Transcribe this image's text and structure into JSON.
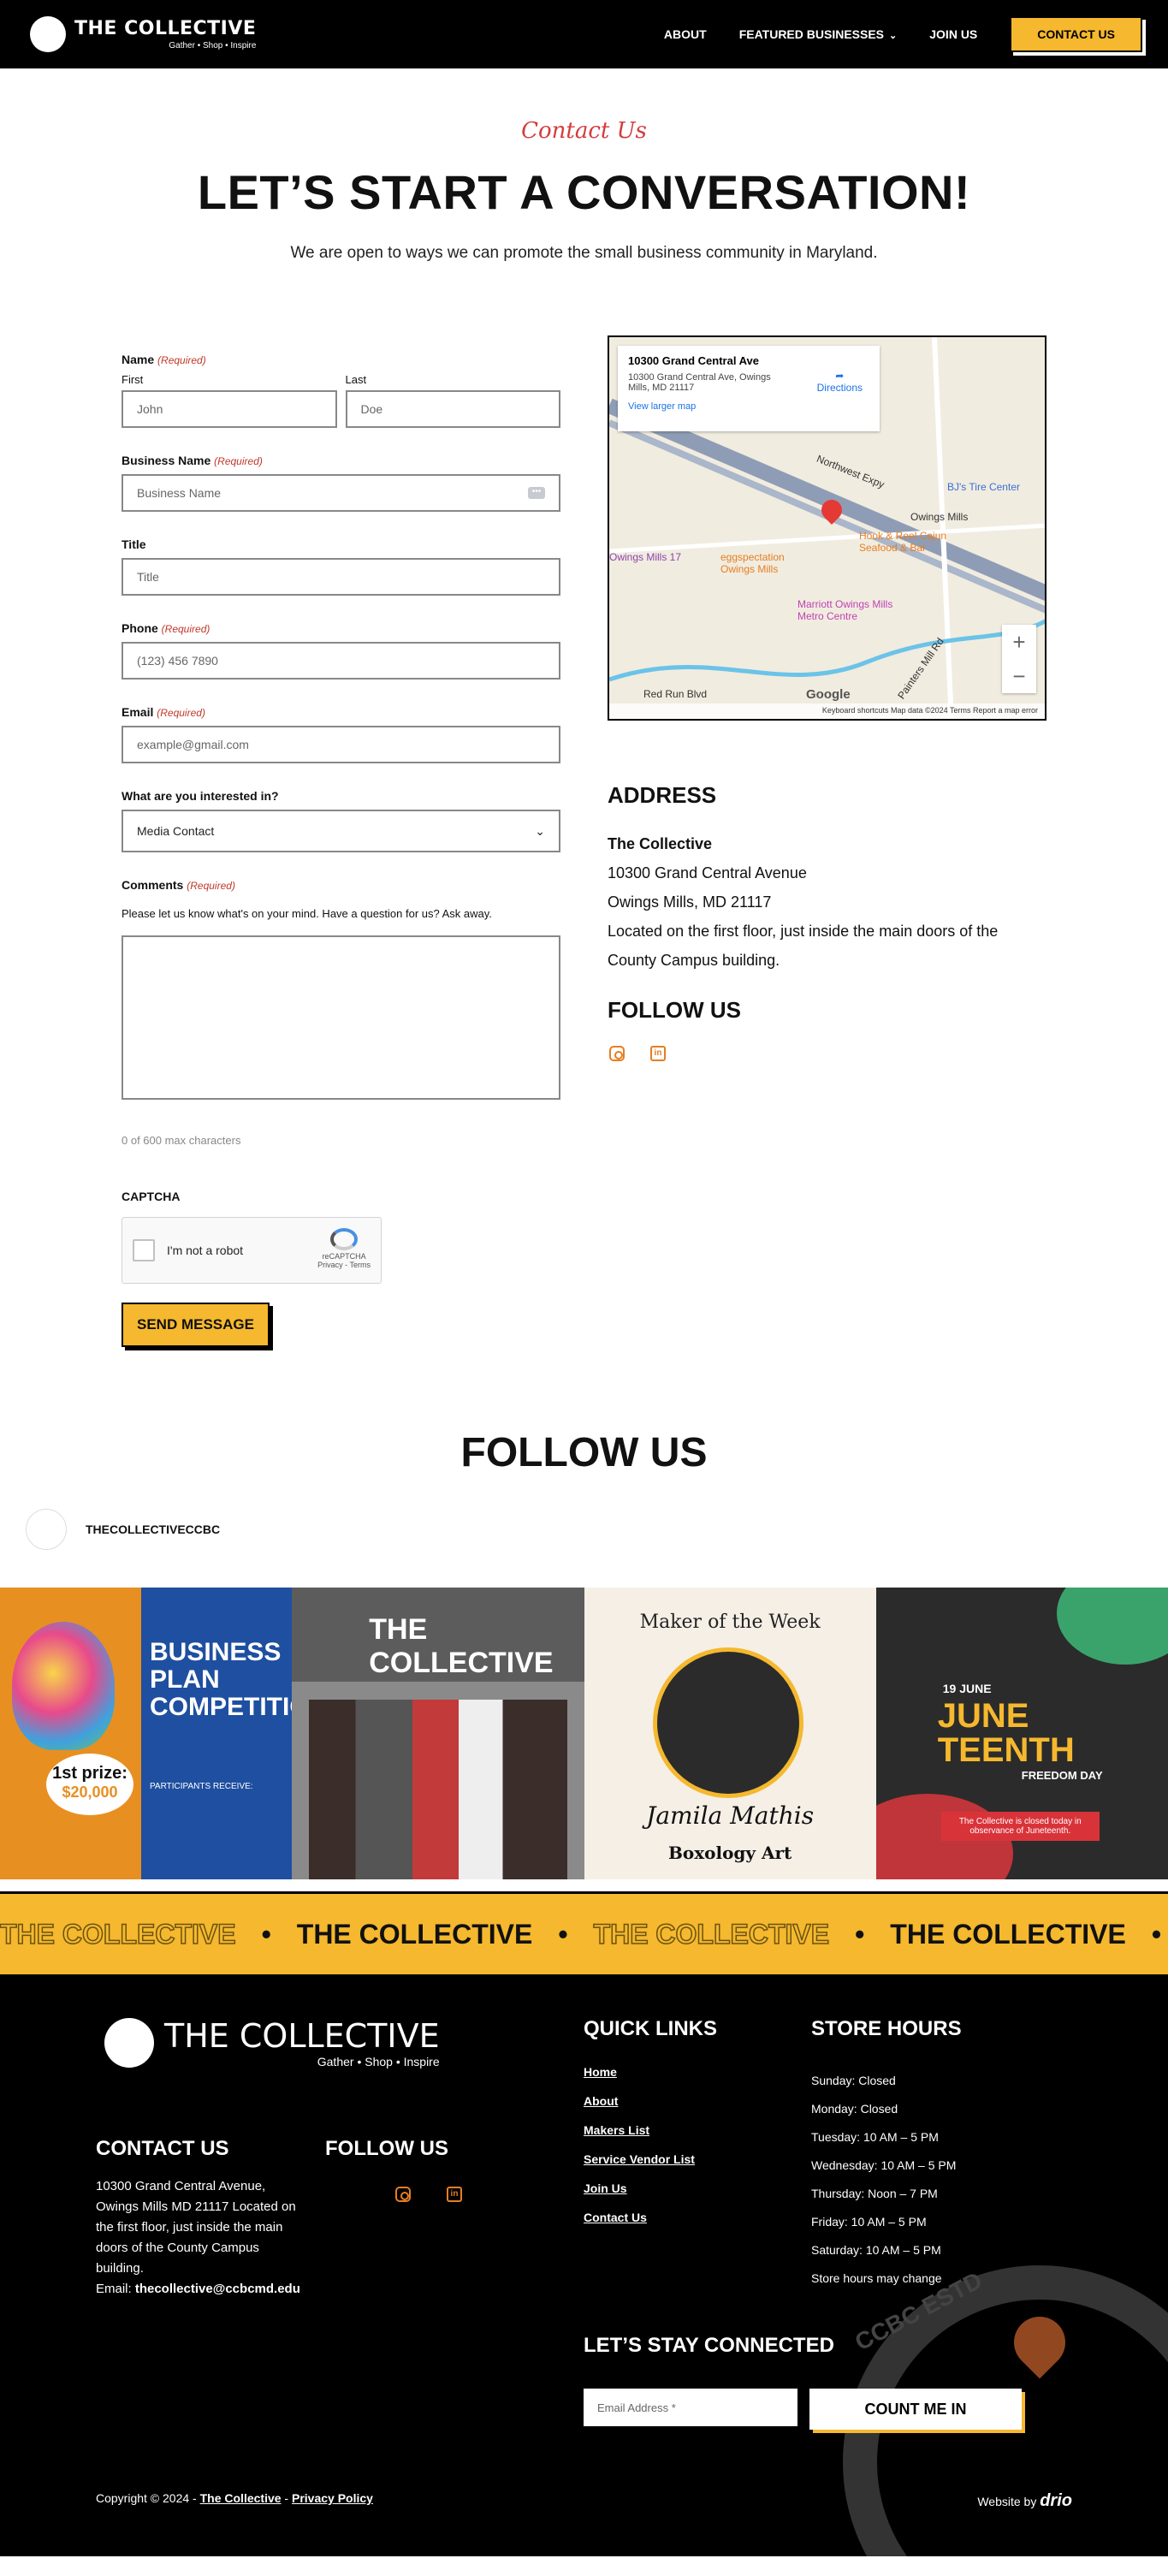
{
  "header": {
    "logo_title": "THE COLLECTIVE",
    "logo_sub": "Gather • Shop • Inspire",
    "nav": {
      "about": "ABOUT",
      "featured": "FEATURED BUSINESSES",
      "join": "JOIN US",
      "contact": "CONTACT US"
    }
  },
  "hero": {
    "eyebrow": "Contact Us",
    "title": "LET’S START A CONVERSATION!",
    "subtitle": "We are open to ways we can promote the small business community in Maryland."
  },
  "form": {
    "required": "(Required)",
    "name_label": "Name",
    "first_label": "First",
    "last_label": "Last",
    "first_placeholder": "John",
    "last_placeholder": "Doe",
    "business_label": "Business Name",
    "business_placeholder": "Business Name",
    "title_label": "Title",
    "title_placeholder": "Title",
    "phone_label": "Phone",
    "phone_placeholder": "(123) 456 7890",
    "email_label": "Email",
    "email_placeholder": "example@gmail.com",
    "interest_label": "What are you interested in?",
    "interest_value": "Media Contact",
    "comments_label": "Comments",
    "comments_hint": "Please let us know what's on your mind. Have a question for us? Ask away.",
    "counter": "0 of 600 max characters",
    "captcha_label": "CAPTCHA",
    "captcha_text": "I'm not a robot",
    "captcha_brand": "reCAPTCHA",
    "captcha_links": "Privacy - Terms",
    "submit": "SEND MESSAGE"
  },
  "map": {
    "place": "10300 Grand Central Ave",
    "address": "10300 Grand Central Ave, Owings Mills, MD 21117",
    "directions": "Directions",
    "view_larger": "View larger map",
    "labels": {
      "a": "Northwest Expy",
      "b": "Hook & Reel Cajun Seafood & Bar",
      "c": "Owings Mills",
      "d": "Marriott Owings Mills Metro Centre",
      "e": "BJ's Tire Center",
      "f": "eggspectation Owings Mills",
      "g": "Owings Mills 17",
      "h": "Painters Mill Rd",
      "i": "Red Run Blvd"
    },
    "footer": "Keyboard shortcuts   Map data ©2024   Terms   Report a map error",
    "google": "Google"
  },
  "address": {
    "heading": "ADDRESS",
    "name": "The Collective",
    "line1": "10300 Grand Central Avenue",
    "line2": "Owings Mills, MD 21117",
    "line3": "Located on the first floor, just inside the main doors of the County Campus building."
  },
  "follow": {
    "heading": "FOLLOW US"
  },
  "feed": {
    "title": "FOLLOW US",
    "handle": "THECOLLECTIVECCBC",
    "post1": {
      "prize_top": "1st prize:",
      "prize_amt": "$20,000",
      "title": "BUSINESS PLAN COMPETITION",
      "perks": "PARTICIPANTS RECEIVE:"
    },
    "post2": {
      "band": "THE COLLECTIVE"
    },
    "post3": {
      "top": "Maker of the Week",
      "name": "Jamila Mathis",
      "shop": "Boxology Art"
    },
    "post4": {
      "date": "19 JUNE",
      "title": "JUNE TEENTH",
      "sub": "FREEDOM DAY",
      "note": "The Collective is closed today in observance of Juneteenth."
    }
  },
  "marquee": {
    "text": "THE COLLECTIVE",
    "sep": "•"
  },
  "footer": {
    "logo_title": "THE COLLECTIVE",
    "logo_sub": "Gather • Shop • Inspire",
    "contact_heading": "CONTACT US",
    "contact_text": "10300 Grand Central Avenue, Owings Mills MD 21117 Located on the first floor, just inside the main doors of the County Campus building.",
    "email_label": "Email: ",
    "email": "thecollective@ccbcmd.edu",
    "follow_heading": "FOLLOW US",
    "quick_heading": "QUICK LINKS",
    "quick_links": [
      "Home",
      "About",
      "Makers List",
      "Service Vendor List",
      "Join Us",
      "Contact Us"
    ],
    "hours_heading": "STORE HOURS",
    "hours": [
      "Sunday: Closed",
      "Monday: Closed",
      "Tuesday: 10 AM – 5 PM",
      "Wednesday: 10 AM – 5 PM",
      "Thursday: Noon – 7 PM",
      "Friday: 10 AM – 5 PM",
      "Saturday: 10 AM – 5 PM",
      "Store hours may change"
    ],
    "news_heading": "LET’S STAY CONNECTED",
    "news_placeholder": "Email Address *",
    "news_button": "COUNT ME IN",
    "copyright": "Copyright © 2024 - ",
    "copy_link1": "The Collective",
    "copy_sep": " - ",
    "copy_link2": "Privacy Policy",
    "website_by": "Website by ",
    "website_brand": "drio",
    "estd": "CCBC ESTD"
  },
  "colors": {
    "accent": "#f5b82e",
    "required": "#c0392b",
    "eyebrow": "#d63b3b",
    "social": "#e67e22"
  }
}
